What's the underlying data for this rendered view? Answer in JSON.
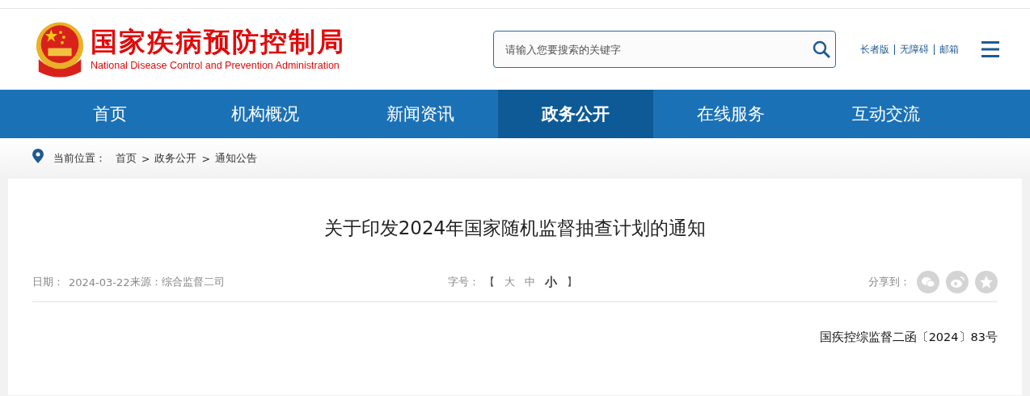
{
  "header": {
    "title": "国家疾病预防控制局",
    "subtitle": "National Disease Control and Prevention Administration",
    "search": {
      "placeholder": "请输入您要搜索的关键字"
    },
    "links": [
      "长者版",
      "无障碍",
      "邮箱"
    ]
  },
  "nav": [
    {
      "label": "首页",
      "selected": false
    },
    {
      "label": "机构概况",
      "selected": false
    },
    {
      "label": "新闻资讯",
      "selected": false
    },
    {
      "label": "政务公开",
      "selected": true
    },
    {
      "label": "在线服务",
      "selected": false
    },
    {
      "label": "互动交流",
      "selected": false
    }
  ],
  "breadcrumb": {
    "label": "当前位置：",
    "items": [
      "首页",
      "政务公开",
      "通知公告"
    ],
    "separator": ">"
  },
  "article": {
    "title": "关于印发2024年国家随机监督抽查计划的通知",
    "date_label": "日期：",
    "date": "2024-03-22",
    "source_label": "来源：",
    "source": "综合监督二司",
    "font_size": {
      "label": "字号：",
      "open": "【",
      "close": "】",
      "options": [
        {
          "label": "大",
          "selected": false
        },
        {
          "label": "中",
          "selected": false
        },
        {
          "label": "小",
          "selected": true
        }
      ]
    },
    "share_label": "分享到：",
    "doc_number": "国疾控综监督二函〔2024〕83号"
  }
}
